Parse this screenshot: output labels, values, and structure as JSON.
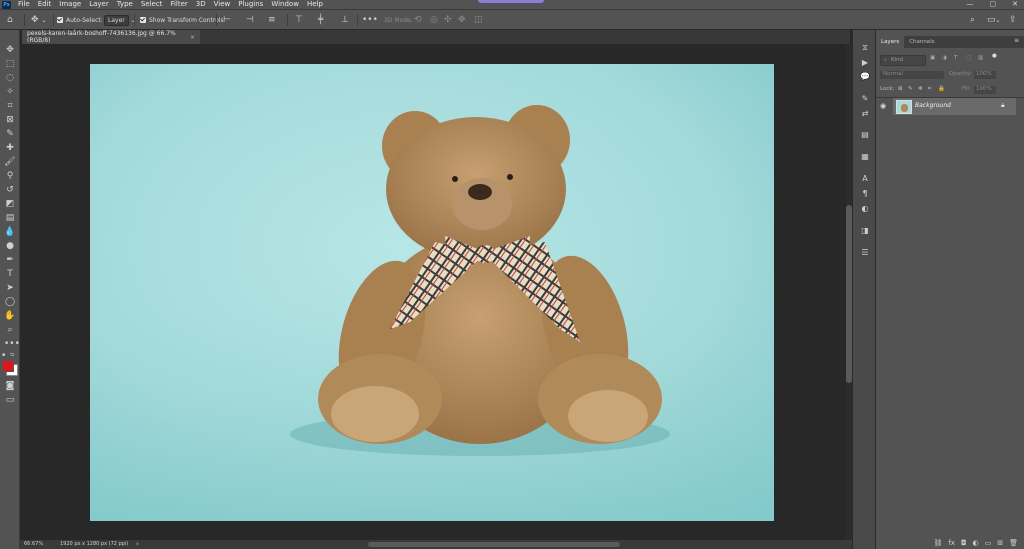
{
  "app": {
    "logo": "Ps",
    "accent": "#31a8ff"
  },
  "menu": [
    "File",
    "Edit",
    "Image",
    "Layer",
    "Type",
    "Select",
    "Filter",
    "3D",
    "View",
    "Plugins",
    "Window",
    "Help"
  ],
  "window_buttons": [
    "—",
    "▢",
    "✕"
  ],
  "options": {
    "auto_select_label": "Auto-Select:",
    "auto_select_value": "Layer",
    "transform_label": "Show Transform Controls",
    "mode_3d": "3D Mode:"
  },
  "document": {
    "tab_title": "pexels-karen-laårk-boshoff-7436136.jpg @ 66.7% (RGB/8)",
    "close": "×",
    "zoom": "66.67%",
    "dimensions": "1920 px x 1280 px (72 ppi)",
    "arrow": "›"
  },
  "layers_panel": {
    "tabs": [
      "Layers",
      "Channels"
    ],
    "kind": "Kind",
    "blend_mode": "Normal",
    "opacity_label": "Opacity:",
    "opacity_value": "100%",
    "lock_label": "Lock:",
    "fill_label": "Fill:",
    "fill_value": "100%",
    "layer_name": "Background"
  },
  "colors": {
    "foreground": "#e0141b",
    "background": "#ffffff",
    "backdrop": "#a8dcdb"
  }
}
